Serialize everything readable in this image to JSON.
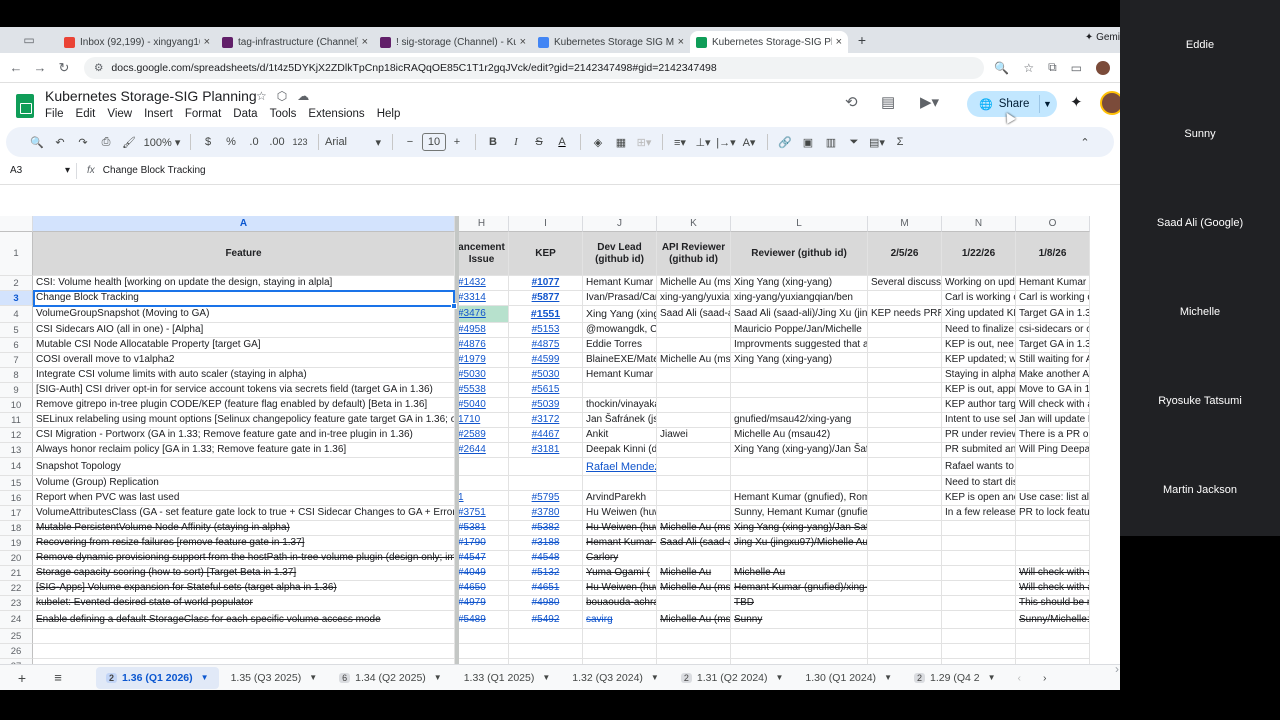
{
  "browser": {
    "tabs": [
      {
        "label": "Inbox (92,199) - xingyang105",
        "icon": "gmail-icon",
        "color": "#ea4335"
      },
      {
        "label": "tag-infrastructure (Channel)",
        "icon": "slack-icon",
        "color": "#611f69"
      },
      {
        "label": "! sig-storage (Channel) - Kub",
        "icon": "slack-icon",
        "color": "#611f69"
      },
      {
        "label": "Kubernetes Storage SIG Mee",
        "icon": "docs-icon",
        "color": "#4285f4"
      },
      {
        "label": "Kubernetes Storage-SIG Plan",
        "icon": "sheets-icon",
        "color": "#0f9d58"
      }
    ],
    "gemini_label": "Gemi",
    "url": "docs.google.com/spreadsheets/d/1t4z5DYKjX2ZDlkTpCnp18icRAQqOE85C1T1r2gqJVck/edit?gid=2142347498#gid=2142347498"
  },
  "doc": {
    "title": "Kubernetes Storage-SIG Planning",
    "menu": [
      "File",
      "Edit",
      "View",
      "Insert",
      "Format",
      "Data",
      "Tools",
      "Extensions",
      "Help"
    ],
    "share_label": "Share"
  },
  "toolbar": {
    "zoom": "100%",
    "currency": "$",
    "percent": "%",
    "dec_dec": ".0",
    "dec_inc": ".00",
    "number_format": "123",
    "font": "Arial",
    "font_size": "10",
    "bold": "B",
    "italic": "I"
  },
  "formula_bar": {
    "cell_ref": "A3",
    "fx": "fx",
    "value": "Change Block Tracking"
  },
  "columns": [
    "A",
    "H",
    "I",
    "J",
    "K",
    "L",
    "M",
    "N",
    "O"
  ],
  "row_numbers": [
    "1",
    "2",
    "3",
    "4",
    "5",
    "6",
    "7",
    "8",
    "9",
    "10",
    "11",
    "12",
    "13",
    "14",
    "15",
    "16",
    "17",
    "18",
    "19",
    "20",
    "21",
    "22",
    "23",
    "24",
    "25",
    "26",
    "27"
  ],
  "header_row": [
    "Feature",
    "ancement Issue",
    "KEP",
    "Dev Lead (github id)",
    "API Reviewer (github id)",
    "Reviewer (github id)",
    "2/5/26",
    "1/22/26",
    "1/8/26"
  ],
  "rows": [
    [
      "CSI: Volume health [working on update the design, staying in alpla]",
      "#1432",
      "#1077",
      "Hemant Kumar (",
      "Michelle Au (ms",
      "Xing Yang (xing-yang)",
      "Several discussi",
      "Working on upda",
      "Hemant Kumar is workin"
    ],
    [
      "Change Block Tracking",
      "#3314",
      "#5877",
      "Ivan/Prasad/Car",
      "xing-yang/yuxian",
      "xing-yang/yuxiangqian/ben",
      "",
      "Carl is working o",
      "Carl is working o"
    ],
    [
      "VolumeGroupSnapshot (Moving to GA)",
      "#3476",
      "#1551",
      "Xing Yang (xing-",
      "Saad Ali (saad-a",
      "Saad Ali (saad-ali)/Jing Xu (jing",
      "KEP needs PRR",
      "Xing updated KE",
      "Target GA in 1.3"
    ],
    [
      "CSI Sidecars AIO (all in one) - [Alpha]",
      "#4958",
      "#5153",
      "@mowangdk, Connor",
      "",
      "Mauricio Poppe/Jan/Michelle",
      "",
      "Need to finalize",
      "csi-sidecars or c"
    ],
    [
      "Mutable CSI Node Allocatable Property [target GA]",
      "#4876",
      "#4875",
      "Eddie Torres",
      "",
      "Improvments suggested that ar",
      "",
      "KEP is out, nee",
      "Target GA in 1.3"
    ],
    [
      "COSI overall move to v1alpha2",
      "#1979",
      "#4599",
      "BlaineEXE/Mate",
      "Michelle Au (ms",
      "Xing Yang (xing-yang)",
      "",
      "KEP updated; w",
      "Still waiting for A"
    ],
    [
      "Integrate CSI volume limits with auto scaler (staying in alpha)",
      "#5030",
      "#5030",
      "Hemant Kumar (gnufied)",
      "",
      "",
      "",
      "Staying in alpha,",
      "Make another Al"
    ],
    [
      "[SIG-Auth] CSI driver opt-in for service account tokens via secrets field (target GA in 1.36)",
      "#5538",
      "#5615",
      "",
      "",
      "",
      "",
      "KEP is out, appr",
      "Move to GA in 1"
    ],
    [
      "Remove gitrepo in-tree plugin CODE/KEP (feature flag enabled by default) [Beta in 1.36]",
      "#5040",
      "#5039",
      "thockin/vinayakankugoyal",
      "",
      "",
      "",
      "KEP author targ",
      "Will check with a"
    ],
    [
      "SELinux relabeling using mount options [Selinux changepolicy feature gate target GA in 1.36; oth",
      "1710",
      "#3172",
      "Jan Šafránek (jsafrane)",
      "",
      "gnufied/msau42/xing-yang",
      "",
      "Intent to use seli",
      "Jan will update K"
    ],
    [
      "CSI Migration - Portworx (GA in 1.33; Remove feature gate and in-tree plugin in 1.36)",
      "#2589",
      "#4467",
      "Ankit",
      "Jiawei",
      "Michelle Au (msau42)",
      "",
      "PR under review",
      "There is a PR ou"
    ],
    [
      "Always honor reclaim policy [GA in 1.33; Remove feature gate in 1.36]",
      "#2644",
      "#3181",
      "Deepak Kinni (deepakkinni)",
      "",
      "Xing Yang (xing-yang)/Jan Šaf",
      "",
      "PR submited and",
      "Will Ping Deepak"
    ],
    [
      "Snapshot Topology",
      "",
      "",
      "Rafael Mendez",
      "",
      "",
      "",
      "Rafael wants to submit a KEP, wa",
      ""
    ],
    [
      "Volume (Group) Replication",
      "",
      "",
      "",
      "",
      "",
      "",
      "Need to start discussion; briefly di",
      ""
    ],
    [
      "Report when PVC was last used",
      "1",
      "#5795",
      "ArvindParekh",
      "",
      "Hemant Kumar (gnufied), Rom",
      "",
      "KEP is open anc",
      "Use case: list all"
    ],
    [
      "VolumeAttributesClass (GA - set feature gate lock to true + CSI Sidecar Changes to GA + Error H",
      "#3751",
      "#3780",
      "Hu Weiwen (huww98)",
      "",
      "Sunny, Hemant Kumar (gnufied",
      "",
      "In a few releases",
      "PR to lock featur"
    ],
    [
      "Mutable PersistentVolume Node Affinity (staying in alpha)",
      "#5381",
      "#5382",
      "Hu Weiwen (huw",
      "Michelle Au (ms",
      "Xing Yang (xing-yang)/Jan Saf",
      "",
      "",
      ""
    ],
    [
      "Recovering from resize failures [remove feature gate in 1.37]",
      "#1790",
      "#3188",
      "Hemant Kumar (",
      "Saad Ali (saad-a",
      "Jing Xu (jingxu97)/Michelle Au",
      "",
      "",
      ""
    ],
    [
      "Remove dynamic provisioning support from the hostPath in-tree volume plugin (design only; impl",
      "#4547",
      "#4548",
      "Carlory",
      "",
      "",
      "",
      "",
      ""
    ],
    [
      "Storage capacity scoring (how to sort) [Target Beta in 1.37]",
      "#4049",
      "#5132",
      "Yuma Ogami (",
      "Michelle Au",
      "Michelle Au",
      "",
      "",
      "Will check with a"
    ],
    [
      "[SIG-Apps] Volume expansion for Stateful sets (target alpha in 1.36)",
      "#4650",
      "#4651",
      "Hu Weiwen (huw",
      "Michelle Au (ms",
      "Hemant Kumar (gnufied)/xing-y",
      "",
      "",
      "Will check with a"
    ],
    [
      "kubelet: Evented desired state of world populator",
      "#4979",
      "#4980",
      "bouaouda-achraf",
      "",
      "TBD",
      "",
      "",
      "This should be re"
    ],
    [
      "Enable defining a default StorageClass for each specific volume access mode",
      "#5489",
      "#5492",
      "savirg",
      "Michelle Au (ms",
      "Sunny",
      "",
      "",
      "Sunny/Michelle:"
    ],
    [
      "",
      "",
      "",
      "",
      "",
      "",
      "",
      "",
      ""
    ],
    [
      "",
      "",
      "",
      "",
      "",
      "",
      "",
      "",
      ""
    ],
    [
      "",
      "",
      "",
      "",
      "",
      "",
      "",
      "",
      ""
    ]
  ],
  "sheet_tabs": [
    {
      "num": "2",
      "label": "1.36 (Q1 2026)"
    },
    {
      "num": "",
      "label": "1.35 (Q3 2025)"
    },
    {
      "num": "6",
      "label": "1.34 (Q2 2025)"
    },
    {
      "num": "",
      "label": "1.33 (Q1 2025)"
    },
    {
      "num": "",
      "label": "1.32 (Q3 2024)"
    },
    {
      "num": "2",
      "label": "1.31 (Q2 2024)"
    },
    {
      "num": "",
      "label": "1.30 (Q1 2024)"
    },
    {
      "num": "2",
      "label": "1.29 (Q4 2"
    }
  ],
  "participants": [
    "Eddie",
    "Sunny",
    "Saad Ali (Google)",
    "Michelle",
    "Ryosuke Tatsumi",
    "Martin Jackson"
  ]
}
